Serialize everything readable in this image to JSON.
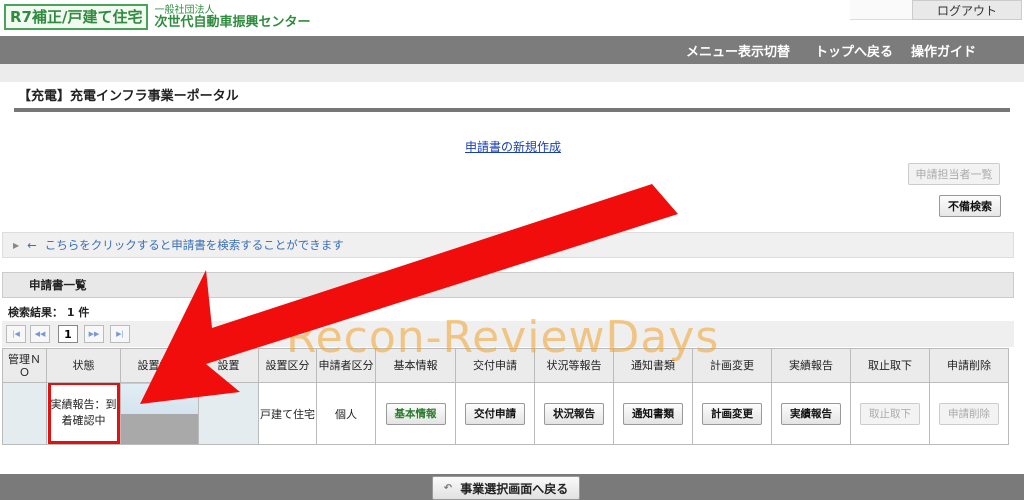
{
  "header": {
    "logo_main": "R7補正/戸建て住宅",
    "logo_org_small": "一般社団法人",
    "logo_org_big": "次世代自動車振興センター",
    "logout": "ログアウト"
  },
  "nav": {
    "items": [
      "メニュー表示切替",
      "トップへ戻る",
      "操作ガイド"
    ]
  },
  "page": {
    "title": "【充電】充電インフラ事業ーポータル",
    "new_link": "申請書の新規作成",
    "applicant_list_btn": "申請担当者一覧",
    "defect_search_btn": "不備検索",
    "search_toggle": "こちらをクリックすると申請書を検索することができます",
    "section_title": "申請書一覧",
    "result_count": "検索結果： 1 件",
    "current_page": "1",
    "back_button": "事業選択画面へ戻る"
  },
  "table": {
    "headers": [
      "管理ＮＯ",
      "状態",
      "設置場所",
      "設置",
      "設置区分",
      "申請者区分",
      "基本情報",
      "交付申請",
      "状況等報告",
      "通知書類",
      "計画変更",
      "実績報告",
      "取止取下",
      "申請削除"
    ],
    "row": {
      "status": "実績報告：到着確認中",
      "setup_type": "戸建て住宅",
      "applicant_type": "個人",
      "btn_basic": "基本情報",
      "btn_grant": "交付申請",
      "btn_status": "状況報告",
      "btn_notice": "通知書類",
      "btn_plan": "計画変更",
      "btn_result": "実績報告",
      "btn_cancel": "取止取下",
      "btn_delete": "申請削除"
    }
  },
  "watermark": "Recon-ReviewDays",
  "colors": {
    "accent_red": "#e31010",
    "nav_bg": "#7c7c7c",
    "logo_green": "#2f8c3e",
    "link_blue": "#1a3fb3"
  }
}
